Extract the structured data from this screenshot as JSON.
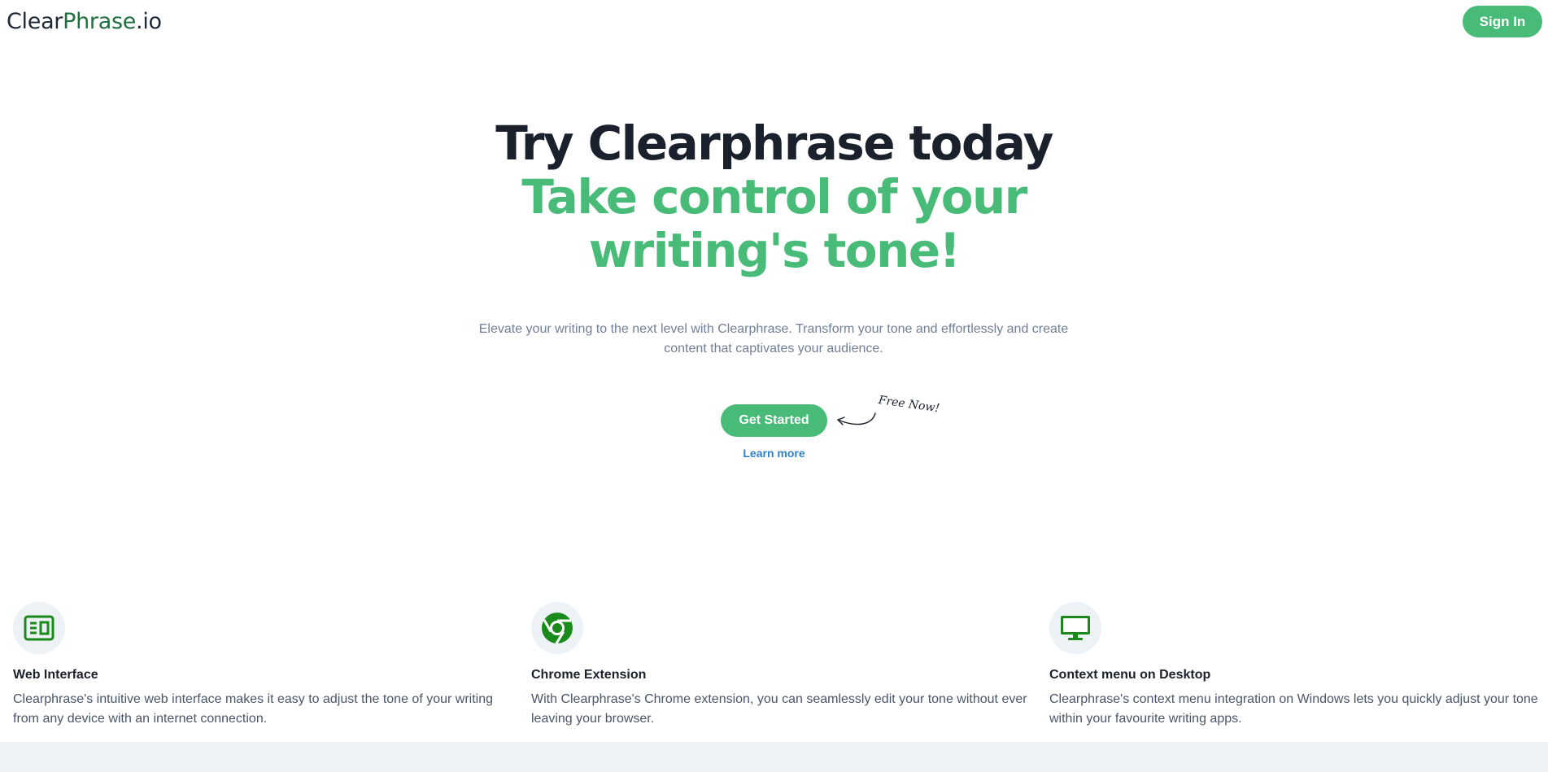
{
  "header": {
    "logo_part1": "Clear",
    "logo_part2": "Phrase",
    "logo_part3": ".io",
    "signin_label": "Sign In"
  },
  "hero": {
    "line1": "Try Clearphrase today",
    "line2": "Take control of your",
    "line3": "writing's tone!",
    "subtitle": "Elevate your writing to the next level with Clearphrase. Transform your tone and effortlessly and create content that captivates your audience.",
    "cta_label": "Get Started",
    "free_label": "Free Now!",
    "learn_more": "Learn more"
  },
  "features": [
    {
      "icon": "web-interface-icon",
      "title": "Web Interface",
      "text": "Clearphrase's intuitive web interface makes it easy to adjust the tone of your writing from any device with an internet connection."
    },
    {
      "icon": "chrome-icon",
      "title": "Chrome Extension",
      "text": "With Clearphrase's Chrome extension, you can seamlessly edit your tone without ever leaving your browser."
    },
    {
      "icon": "desktop-icon",
      "title": "Context menu on Desktop",
      "text": "Clearphrase's context menu integration on Windows lets you quickly adjust your tone within your favourite writing apps."
    }
  ],
  "colors": {
    "accent": "#48bb78",
    "logo_accent": "#1f6f3f",
    "link": "#3182ce",
    "icon_green": "#1a8a1a"
  }
}
